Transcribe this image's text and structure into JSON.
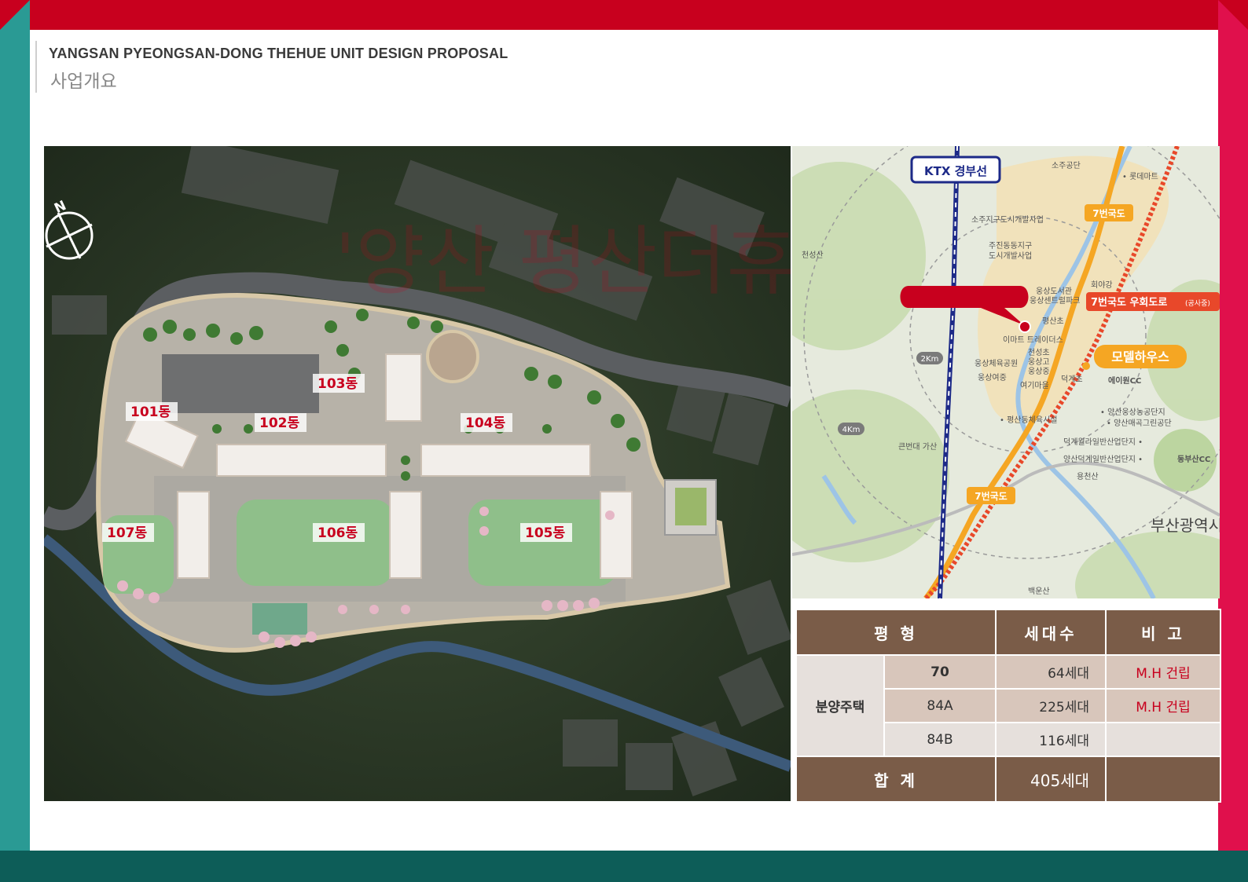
{
  "header": {
    "title_en": "YANGSAN PYEONGSAN-DONG THEHUE UNIT DESIGN PROPOSAL",
    "title_ko": "사업개요"
  },
  "site_plan": {
    "north_label": "N",
    "buildings": [
      "101동",
      "102동",
      "103동",
      "104동",
      "105동",
      "106동",
      "107동"
    ],
    "watermark": "'양산 평산더휴'"
  },
  "location_map": {
    "rail_label": "KTX 경부선",
    "road_7": "7번국도",
    "bypass": "7번국도 우회도로",
    "bypass_note": "(공사중)",
    "model_house": "모델하우스",
    "radius_2km": "2Km",
    "radius_4km": "4Km",
    "busan": "부산광역시",
    "places": {
      "sojugongdan": "소주공단",
      "emart": "• 롯데마트",
      "soju_dev": "소주지구도시개발사업",
      "juchin": "주진동동지구",
      "juchin_dev": "도시개발사업",
      "cheonseongsan": "천성산",
      "hoeyagang": "회야강",
      "ungsang_center": "웅상도서관",
      "ungsang_park": "웅상센트럴파크",
      "pyeongsan_elem": "평산초",
      "emart2": "이마트 트레이더스",
      "cheonseong_elem": "천성초",
      "ungsang_high": "웅상고",
      "ungsang_mid": "웅상중",
      "ungsang_gym": "웅상체육공원",
      "ungsang_girls": "웅상여중",
      "yegi_mid": "여기마을",
      "deokgye": "덕계초",
      "aewon_cc": "에이원CC",
      "yangsan_ag": "• 양산웅상농공단지",
      "yangsan_ag2": "• 양산매곡그린공단",
      "pyeongsan_sports": "• 평산동체육시설",
      "keunbeondae": "큰번대 가산",
      "deokgye_ind": "덕계월라일반산업단지 •",
      "yangsan_ind": "양산덕계일반산업단지 •",
      "yongcheon": "용천산",
      "dongbusan_cc": "동부산CC",
      "baekunsan": "백운산"
    }
  },
  "table": {
    "headers": [
      "평 형",
      "세대수",
      "비 고"
    ],
    "category": "분양주택",
    "rows": [
      {
        "type": "70",
        "count": "64세대",
        "note": "M.H 건립"
      },
      {
        "type": "84A",
        "count": "225세대",
        "note": "M.H 건립"
      },
      {
        "type": "84B",
        "count": "116세대",
        "note": ""
      }
    ],
    "total_label": "합 계",
    "total_count": "405세대",
    "total_note": ""
  }
}
